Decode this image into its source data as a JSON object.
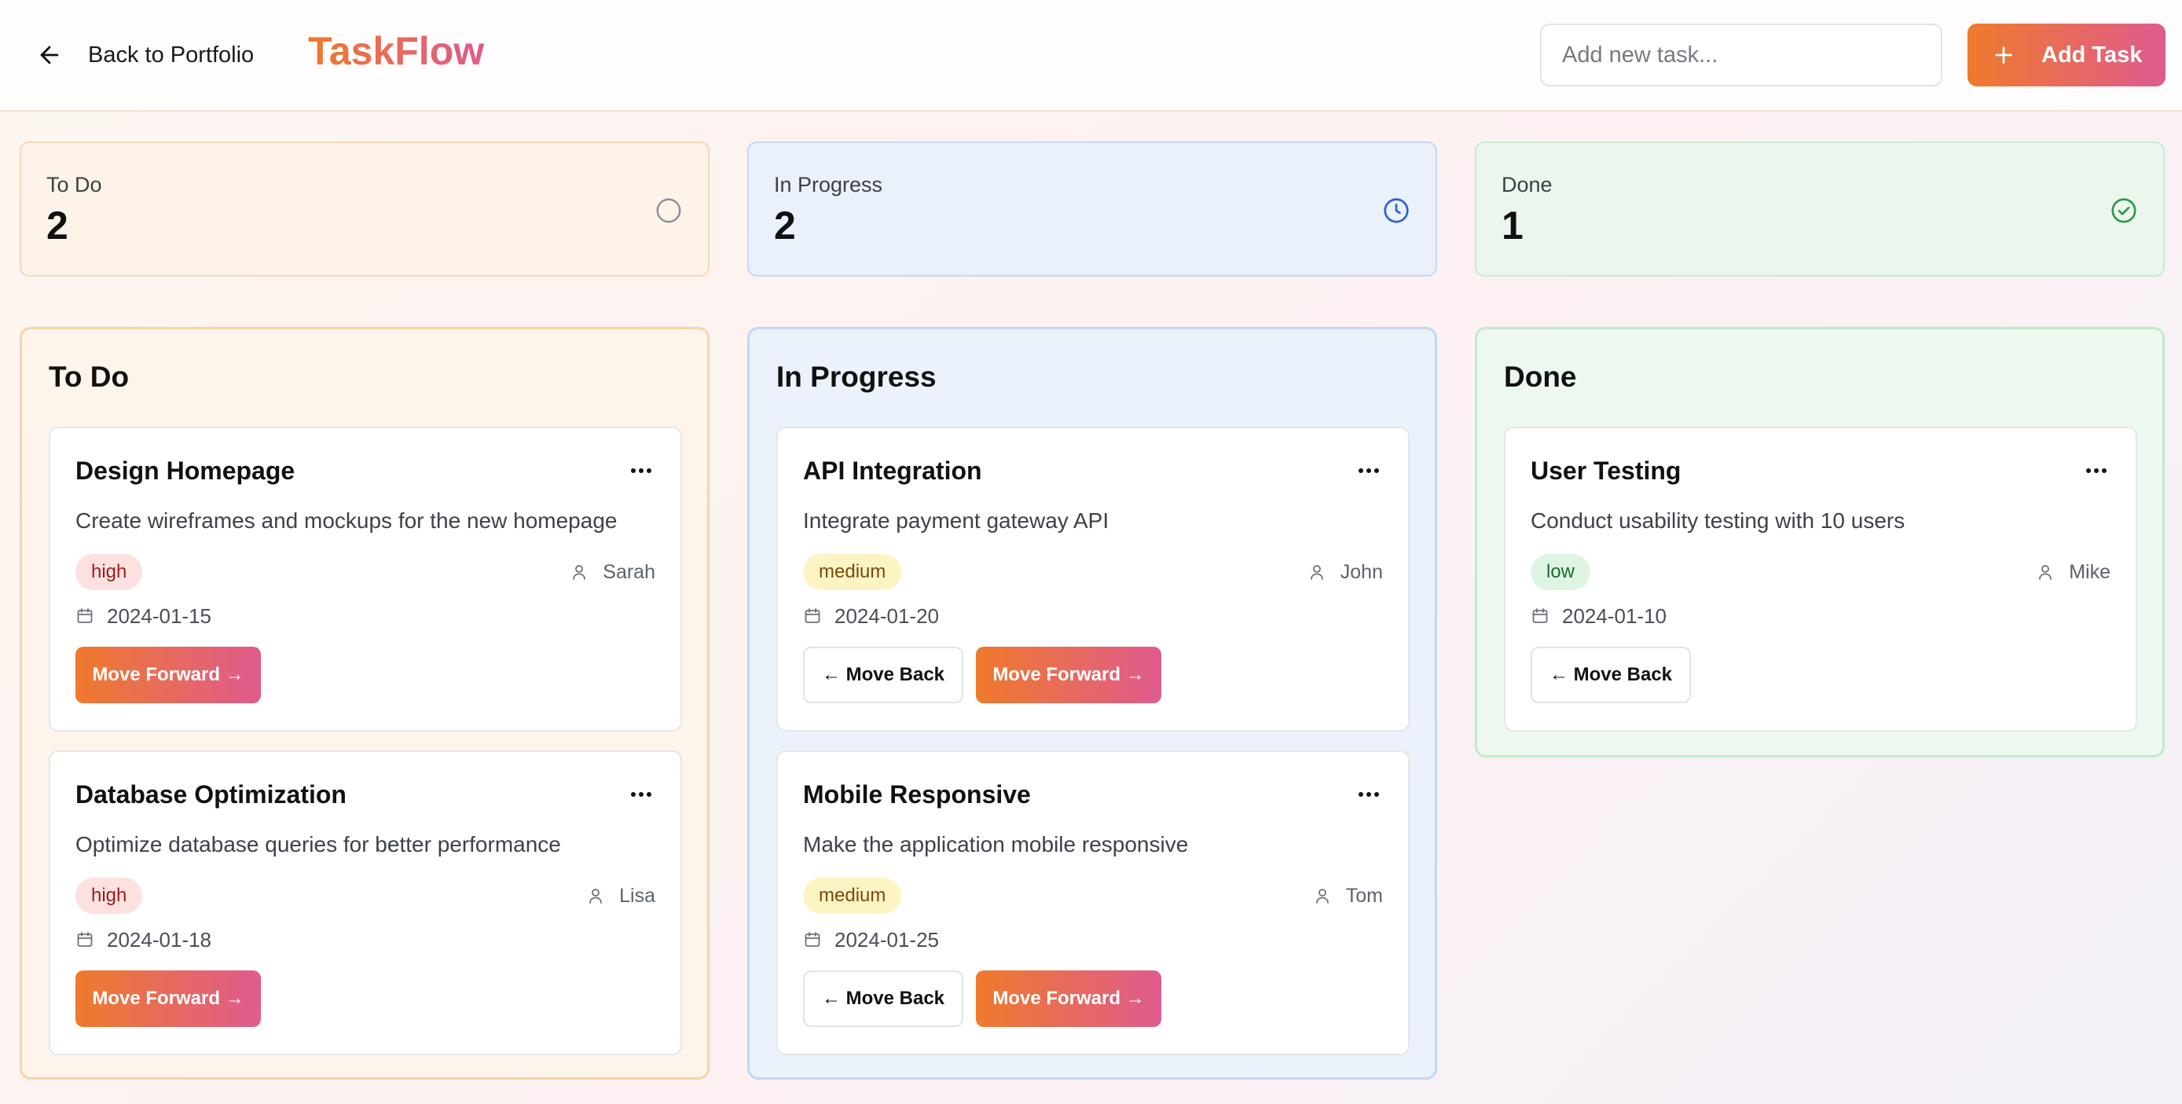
{
  "header": {
    "back_label": "Back to Portfolio",
    "brand": "TaskFlow",
    "new_task_placeholder": "Add new task...",
    "add_button_label": "Add Task"
  },
  "summary": [
    {
      "label": "To Do",
      "count": "2",
      "icon": "circle-icon"
    },
    {
      "label": "In Progress",
      "count": "2",
      "icon": "clock-icon"
    },
    {
      "label": "Done",
      "count": "1",
      "icon": "check-circle-icon"
    }
  ],
  "columns": [
    {
      "title": "To Do",
      "cards": [
        {
          "title": "Design Homepage",
          "description": "Create wireframes and mockups for the new homepage",
          "priority": "high",
          "assignee": "Sarah",
          "due": "2024-01-15",
          "forward_label": "Move Forward →"
        },
        {
          "title": "Database Optimization",
          "description": "Optimize database queries for better performance",
          "priority": "high",
          "assignee": "Lisa",
          "due": "2024-01-18",
          "forward_label": "Move Forward →"
        }
      ]
    },
    {
      "title": "In Progress",
      "cards": [
        {
          "title": "API Integration",
          "description": "Integrate payment gateway API",
          "priority": "medium",
          "assignee": "John",
          "due": "2024-01-20",
          "back_label": "← Move Back",
          "forward_label": "Move Forward →"
        },
        {
          "title": "Mobile Responsive",
          "description": "Make the application mobile responsive",
          "priority": "medium",
          "assignee": "Tom",
          "due": "2024-01-25",
          "back_label": "← Move Back",
          "forward_label": "Move Forward →"
        }
      ]
    },
    {
      "title": "Done",
      "cards": [
        {
          "title": "User Testing",
          "description": "Conduct usability testing with 10 users",
          "priority": "low",
          "assignee": "Mike",
          "due": "2024-01-10",
          "back_label": "← Move Back"
        }
      ]
    }
  ],
  "colors": {
    "accent_start": "#ef7a2c",
    "accent_end": "#df5b8e",
    "todo": "#f8d4a8",
    "in_progress": "#c4d6f6",
    "done": "#c2eacb"
  }
}
